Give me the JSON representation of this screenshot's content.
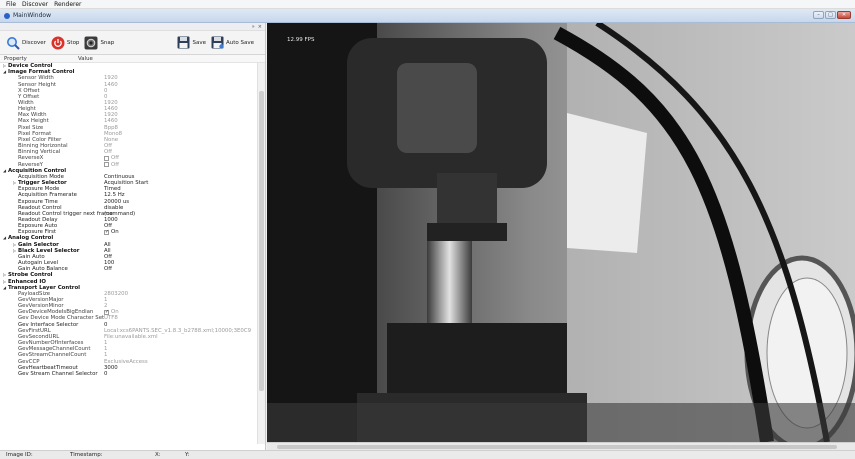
{
  "menu": [
    "File",
    "Discover",
    "Renderer"
  ],
  "window": {
    "title": "MainWindow"
  },
  "dock": {
    "float_label": "»",
    "close_label": "×"
  },
  "toolbar": {
    "discover": "Discover",
    "stop": "Stop",
    "snap": "Snap",
    "save": "Save",
    "auto_save": "Auto Save"
  },
  "table": {
    "col_property": "Property",
    "col_value": "Value"
  },
  "rows": [
    {
      "t": "group",
      "name": "Device Control",
      "val": "",
      "arrow": "▷"
    },
    {
      "t": "group",
      "name": "Image Format Control",
      "val": "",
      "arrow": "◢"
    },
    {
      "t": "ro",
      "name": "Sensor Width",
      "val": "1920"
    },
    {
      "t": "ro",
      "name": "Sensor Height",
      "val": "1460"
    },
    {
      "t": "ro",
      "name": "X Offset",
      "val": "0"
    },
    {
      "t": "ro",
      "name": "Y Offset",
      "val": "0"
    },
    {
      "t": "ro",
      "name": "Width",
      "val": "1920"
    },
    {
      "t": "ro",
      "name": "Height",
      "val": "1460"
    },
    {
      "t": "ro",
      "name": "Max Width",
      "val": "1920"
    },
    {
      "t": "ro",
      "name": "Max Height",
      "val": "1460"
    },
    {
      "t": "ro",
      "name": "Pixel Size",
      "val": "Bpp8"
    },
    {
      "t": "ro",
      "name": "Pixel Format",
      "val": "Mono8"
    },
    {
      "t": "ro",
      "name": "Pixel Color Filter",
      "val": "None"
    },
    {
      "t": "ro",
      "name": "Binning Horizontal",
      "val": "Off"
    },
    {
      "t": "ro",
      "name": "Binning Vertical",
      "val": "Off"
    },
    {
      "t": "ro",
      "name": "ReverseX",
      "val": "Off",
      "cb": "off"
    },
    {
      "t": "ro",
      "name": "ReverseY",
      "val": "Off",
      "cb": "off"
    },
    {
      "t": "group",
      "name": "Acquisition Control",
      "val": "",
      "arrow": "◢"
    },
    {
      "t": "rw",
      "name": "Acquisition Mode",
      "val": "Continuous"
    },
    {
      "t": "subgroup",
      "name": "Trigger Selector",
      "val": "Acquisition Start",
      "arrow": "▷"
    },
    {
      "t": "rw",
      "name": "Exposure Mode",
      "val": "Timed"
    },
    {
      "t": "rw",
      "name": "Acquisition Framerate",
      "val": "12.5 Hz"
    },
    {
      "t": "rw",
      "name": "Exposure Time",
      "val": "20000 us"
    },
    {
      "t": "rw",
      "name": "Readout Control",
      "val": "disable"
    },
    {
      "t": "rw",
      "name": "Readout Control trigger next frame",
      "val": "(command)"
    },
    {
      "t": "rw",
      "name": "Readout Delay",
      "val": "1000"
    },
    {
      "t": "rw",
      "name": "Exposure Auto",
      "val": "Off"
    },
    {
      "t": "rw",
      "name": "Exposure First",
      "val": "On",
      "cb": "on"
    },
    {
      "t": "group",
      "name": "Analog Control",
      "val": "",
      "arrow": "◢"
    },
    {
      "t": "subgroup",
      "name": "Gain Selector",
      "val": "All",
      "arrow": "▷"
    },
    {
      "t": "subgroup",
      "name": "Black Level Selector",
      "val": "All",
      "arrow": "▷"
    },
    {
      "t": "rw",
      "name": "Gain Auto",
      "val": "Off"
    },
    {
      "t": "rw",
      "name": "Autogain Level",
      "val": "100"
    },
    {
      "t": "rw",
      "name": "Gain Auto Balance",
      "val": "Off"
    },
    {
      "t": "group",
      "name": "Strobe Control",
      "val": "",
      "arrow": "▷"
    },
    {
      "t": "group",
      "name": "Enhanced IO",
      "val": "",
      "arrow": "▷"
    },
    {
      "t": "group",
      "name": "Transport Layer Control",
      "val": "",
      "arrow": "◢"
    },
    {
      "t": "ro",
      "name": "PayloadSize",
      "val": "2803200"
    },
    {
      "t": "ro",
      "name": "GevVersionMajor",
      "val": "1"
    },
    {
      "t": "ro",
      "name": "GevVersionMinor",
      "val": "2"
    },
    {
      "t": "ro",
      "name": "GevDeviceModeIsBigEndian",
      "val": "On",
      "cb": "on"
    },
    {
      "t": "ro",
      "name": "Gev Device Mode Character Set",
      "val": "UTF8"
    },
    {
      "t": "rw",
      "name": "Gev Interface Selector",
      "val": "0"
    },
    {
      "t": "ro",
      "name": "GevFirstURL",
      "val": "Local:xcs6PANTS.SEC_v1.8.3_b2788.xml;10000;3E0C9"
    },
    {
      "t": "ro",
      "name": "GevSecondURL",
      "val": "File:unavailable.xml"
    },
    {
      "t": "ro",
      "name": "GevNumberOfInterfaces",
      "val": "1"
    },
    {
      "t": "ro",
      "name": "GevMessageChannelCount",
      "val": "1"
    },
    {
      "t": "ro",
      "name": "GevStreamChannelCount",
      "val": "1"
    },
    {
      "t": "ro",
      "name": "GevCCP",
      "val": "ExclusiveAccess"
    },
    {
      "t": "rw",
      "name": "GevHeartbeatTimeout",
      "val": "3000"
    },
    {
      "t": "rw",
      "name": "Gev Stream Channel Selector",
      "val": "0"
    }
  ],
  "viewer": {
    "fps": "12.99 FPS"
  },
  "status": {
    "image_id": "Image ID:",
    "timestamp": "Timestamp:",
    "x": "X:",
    "y": "Y:"
  },
  "colors": {
    "title_blue": "#c7d7ec",
    "stop_red": "#d9342b",
    "discover_blue": "#3a7bd5"
  }
}
